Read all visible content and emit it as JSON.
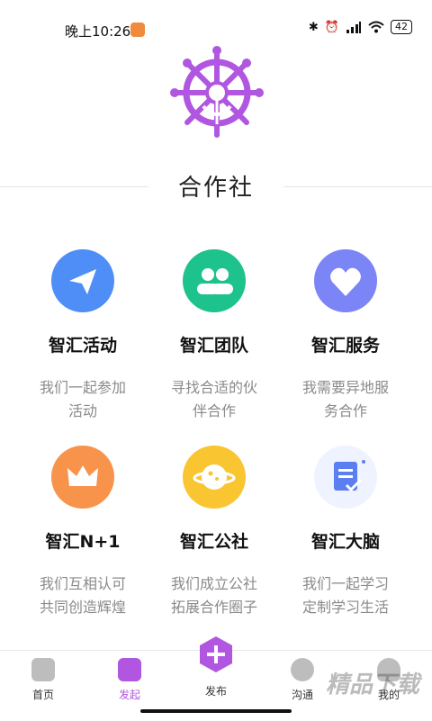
{
  "status": {
    "time": "晚上10:26",
    "battery": "42"
  },
  "page": {
    "title": "合作社"
  },
  "cards": [
    {
      "title": "智汇活动",
      "desc": "我们一起参加活动",
      "icon": "paper-plane-icon",
      "color": "#4f8ef7"
    },
    {
      "title": "智汇团队",
      "desc": "寻找合适的伙伴合作",
      "icon": "people-icon",
      "color": "#1dc28d"
    },
    {
      "title": "智汇服务",
      "desc": "我需要异地服务合作",
      "icon": "heart-icon",
      "color": "#7b85f5"
    },
    {
      "title": "智汇N+1",
      "desc": "我们互相认可共同创造辉煌",
      "icon": "crown-icon",
      "color": "#f8934b"
    },
    {
      "title": "智汇公社",
      "desc": "我们成立公社拓展合作圈子",
      "icon": "planet-icon",
      "color": "#f9c531"
    },
    {
      "title": "智汇大脑",
      "desc": "我们一起学习定制学习生活",
      "icon": "document-icon",
      "color": "#5b7ef0"
    }
  ],
  "tabs": [
    {
      "label": "首页",
      "icon": "home-icon",
      "color": "#9a9a9a",
      "active": false
    },
    {
      "label": "发起",
      "icon": "cube-icon",
      "color": "#b056e0",
      "active": true
    },
    {
      "label": "发布",
      "icon": "plus-icon",
      "color": "#b056e0",
      "active": false
    },
    {
      "label": "沟通",
      "icon": "chat-icon",
      "color": "#9a9a9a",
      "active": false
    },
    {
      "label": "我的",
      "icon": "user-icon",
      "color": "#9a9a9a",
      "active": false
    }
  ],
  "watermark": "精品下载",
  "accent": "#b056e0"
}
